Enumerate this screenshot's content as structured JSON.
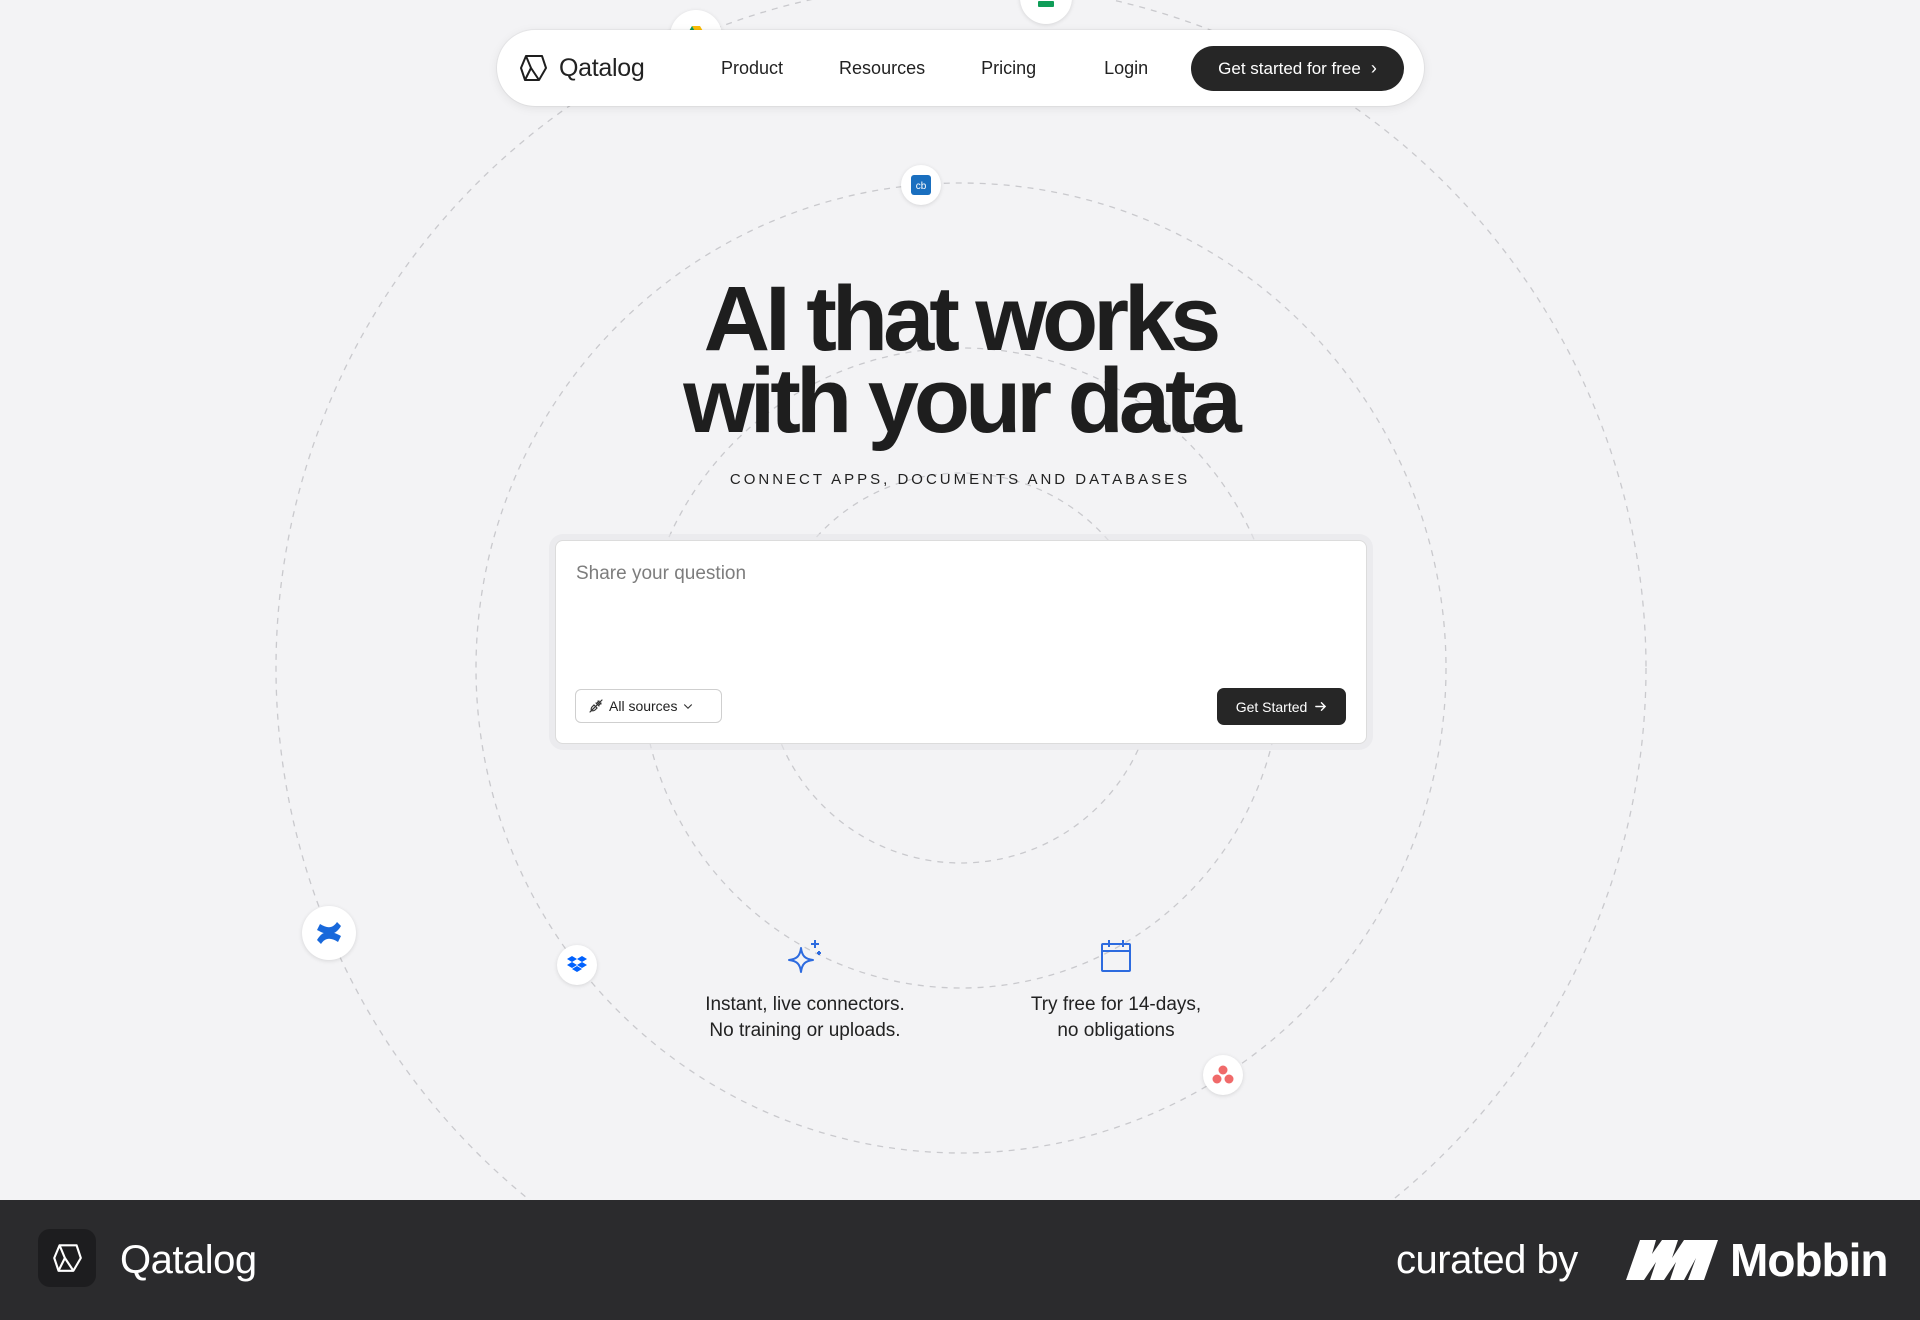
{
  "nav": {
    "brand": "Qatalog",
    "links": [
      "Product",
      "Resources",
      "Pricing"
    ],
    "login": "Login",
    "cta": "Get started for free"
  },
  "hero": {
    "title_line1": "AI that works",
    "title_line2": "with your data",
    "subtitle": "CONNECT APPS, DOCUMENTS AND DATABASES"
  },
  "question_box": {
    "placeholder": "Share your question",
    "sources_label": "All sources",
    "submit_label": "Get Started"
  },
  "features": [
    {
      "icon": "sparkle-icon",
      "line1": "Instant, live connectors.",
      "line2": "No training or uploads."
    },
    {
      "icon": "calendar-icon",
      "line1": "Try free for 14-days,",
      "line2": "no obligations"
    }
  ],
  "orbit_apps": [
    "google-drive-icon",
    "google-sheets-icon",
    "chargebee-icon",
    "confluence-icon",
    "dropbox-icon",
    "asana-icon"
  ],
  "colors": {
    "background": "#f3f3f5",
    "dark_button": "#262626",
    "accent_blue": "#2d6bdf",
    "footer": "#2b2b2d"
  },
  "footer": {
    "brand": "Qatalog",
    "curated_by": "curated by",
    "mobbin": "Mobbin"
  }
}
